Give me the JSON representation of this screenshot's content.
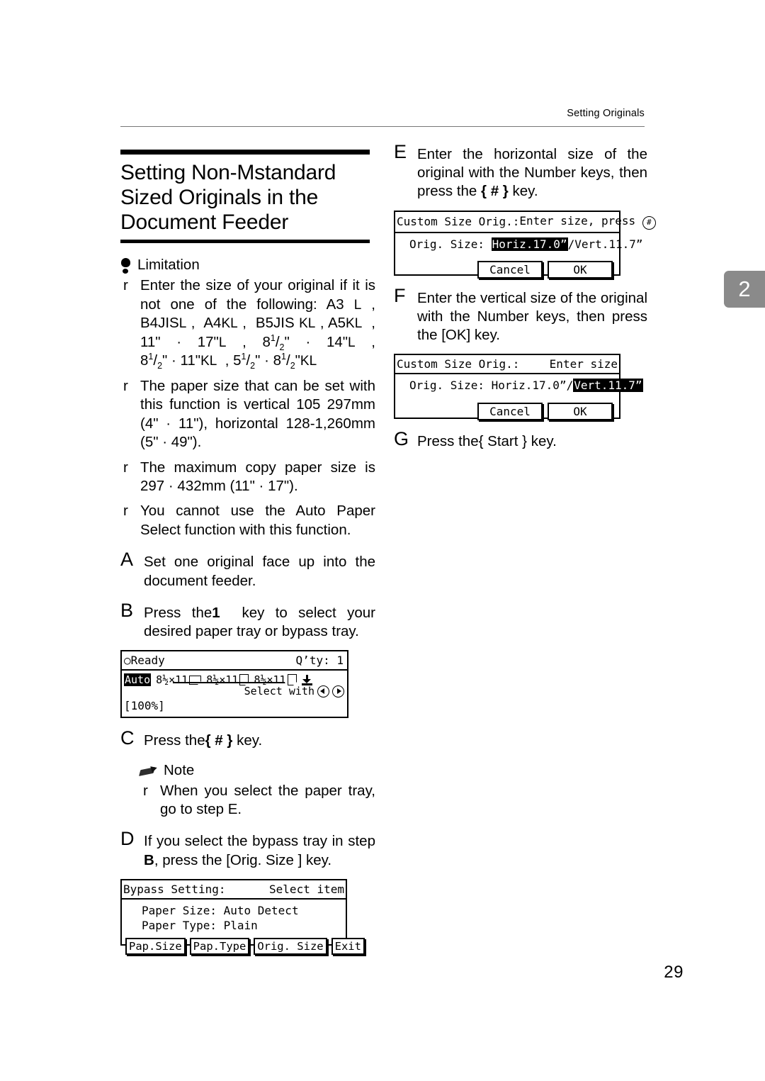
{
  "page": {
    "running_head": "Setting Originals",
    "folio": "29",
    "chapter_tab": "2"
  },
  "section": {
    "title": "Setting Non-Mstandard Sized Originals in the Document Feeder"
  },
  "limitation": {
    "heading": "Limitation",
    "bullet_mark": "r",
    "items": [
      {
        "lead": "Enter the size of your original if it is not one of the following: A3",
        "sizes": "A3 L , B4JIS L , A4 KL , B5JIS KL , A5 KL , 11\" · 17\" L , 8 1/2\" · 14\" L , 8 1/2\" · 11\" KL , 5 1/2\" · 8 1/2\" KL"
      },
      {
        "text": "The paper size that can be set with this function is vertical 105 297mm (4\" · 11\"), horizontal 128-1,260mm (5\" · 49\")."
      },
      {
        "text": "The maximum copy paper size is 297 · 432mm (11\" · 17\")."
      },
      {
        "text": "You cannot use the Auto Paper Select function with this function."
      }
    ]
  },
  "note": {
    "heading": "Note",
    "bullet_mark": "r",
    "items": [
      {
        "text": "When you select the paper tray, go to step E."
      }
    ]
  },
  "steps": {
    "a": {
      "letter": "A",
      "text": "Set one original face up into the document feeder."
    },
    "b": {
      "letter": "B",
      "text_before": "Press the",
      "key": "1",
      "text_after": "key to select your desired paper tray or bypass tray."
    },
    "c": {
      "letter": "C",
      "text_before": "Press the",
      "key": "{ # }",
      "text_after": "key."
    },
    "d": {
      "letter": "D",
      "text_before": "If you select the bypass tray in step",
      "step_ref": "B",
      "text_mid": ", press the",
      "key": "[Orig. Size ]",
      "text_after": "key."
    },
    "e": {
      "letter": "E",
      "text_before": "Enter the horizontal size of the original with the Number keys, then press the",
      "key": "{ # }",
      "text_after": "key."
    },
    "f": {
      "letter": "F",
      "text_before": "Enter the vertical size of the original with the Number keys, then press the",
      "key": "[OK]",
      "text_after": "key."
    },
    "g": {
      "letter": "G",
      "text_before": "Press the",
      "key": "{ Start }",
      "text_after": "key."
    }
  },
  "lcd_ready": {
    "status": "Ready",
    "qty_label": "Q’ty:",
    "qty_value": "1",
    "auto_label": "Auto",
    "trays": [
      {
        "size": "8½×11",
        "orientation": "landscape"
      },
      {
        "size": "8½×11",
        "orientation": "portrait"
      },
      {
        "size": "8½×11",
        "orientation": "portrait"
      }
    ],
    "bypass_icon": "bypass-tray-icon",
    "select_with": "Select with",
    "zoom": "[100%]"
  },
  "lcd_custom_horiz": {
    "title": "Custom Size Orig.:",
    "hint": "Enter size, press",
    "hint_key": "#",
    "field_label": "Orig. Size:",
    "horiz_value": "Horiz.17.0”",
    "separator": "/",
    "vert_value": "Vert.11.7”",
    "highlight": "horiz",
    "cancel": "Cancel",
    "ok": "OK"
  },
  "lcd_custom_vert": {
    "title": "Custom Size Orig.:",
    "hint": "Enter size",
    "field_label": "Orig. Size:",
    "horiz_value": "Horiz.17.0”",
    "separator": "/",
    "vert_value": "Vert.11.7”",
    "highlight": "vert",
    "cancel": "Cancel",
    "ok": "OK"
  },
  "lcd_bypass": {
    "title": "Bypass Setting:",
    "hint": "Select item",
    "rows": [
      {
        "label": "Paper Size:",
        "value": "Auto Detect"
      },
      {
        "label": "Paper Type:",
        "value": "Plain"
      }
    ],
    "buttons": [
      "Pap.Size",
      "Pap.Type",
      "Orig. Size",
      "Exit"
    ]
  }
}
